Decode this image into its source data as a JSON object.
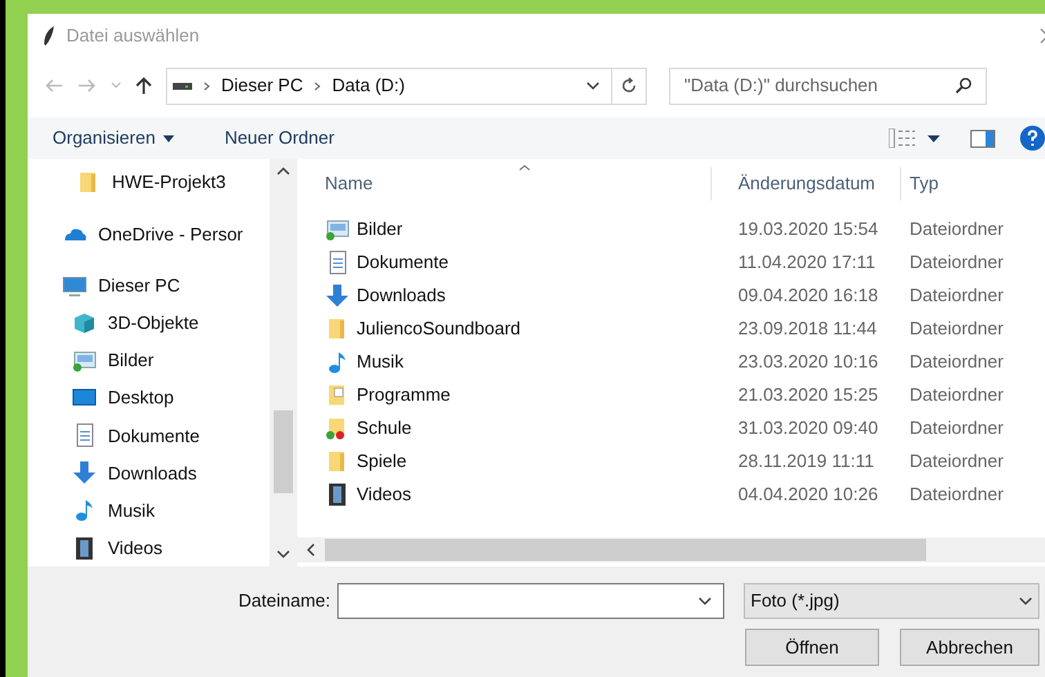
{
  "window": {
    "title": "Datei auswählen"
  },
  "address_bar": {
    "path": [
      "Dieser PC",
      "Data (D:)"
    ]
  },
  "search": {
    "placeholder": "\"Data (D:)\" durchsuchen"
  },
  "toolbar": {
    "buttons": [
      "Organisieren",
      "Neuer Ordner"
    ]
  },
  "sidebar": {
    "items": [
      {
        "label": "HWE-Projekt3",
        "kind": "folder",
        "indented": true
      },
      {
        "label": "OneDrive - Persor",
        "kind": "cloud",
        "indented": false
      },
      {
        "label": "Dieser PC",
        "kind": "pc",
        "indented": false,
        "children": [
          {
            "label": "3D-Objekte",
            "kind": "cube"
          },
          {
            "label": "Bilder",
            "kind": "pictures"
          },
          {
            "label": "Desktop",
            "kind": "desktop"
          },
          {
            "label": "Dokumente",
            "kind": "documents"
          },
          {
            "label": "Downloads",
            "kind": "downloads"
          },
          {
            "label": "Musik",
            "kind": "music"
          },
          {
            "label": "Videos",
            "kind": "videos"
          }
        ]
      }
    ]
  },
  "table": {
    "columns": [
      "Name",
      "Änderungsdatum",
      "Typ"
    ],
    "rows": [
      {
        "name": "Bilder",
        "kind": "pictures",
        "date": "19.03.2020 15:54",
        "type": "Dateiordner"
      },
      {
        "name": "Dokumente",
        "kind": "documents",
        "date": "11.04.2020 17:11",
        "type": "Dateiordner"
      },
      {
        "name": "Downloads",
        "kind": "downloads",
        "date": "09.04.2020 16:18",
        "type": "Dateiordner"
      },
      {
        "name": "JuliencoSoundboard",
        "kind": "folder",
        "date": "23.09.2018 11:44",
        "type": "Dateiordner"
      },
      {
        "name": "Musik",
        "kind": "music",
        "date": "23.03.2020 10:16",
        "type": "Dateiordner"
      },
      {
        "name": "Programme",
        "kind": "programs",
        "date": "21.03.2020 15:25",
        "type": "Dateiordner"
      },
      {
        "name": "Schule",
        "kind": "synced",
        "date": "31.03.2020 09:40",
        "type": "Dateiordner"
      },
      {
        "name": "Spiele",
        "kind": "folder",
        "date": "28.11.2019 11:11",
        "type": "Dateiordner"
      },
      {
        "name": "Videos",
        "kind": "videos",
        "date": "04.04.2020 10:26",
        "type": "Dateiordner"
      }
    ]
  },
  "file_name": {
    "label": "Dateiname:"
  },
  "file_type": {
    "value": "Foto (*.jpg)"
  },
  "buttons": [
    "Öffnen",
    "Abbrechen"
  ]
}
